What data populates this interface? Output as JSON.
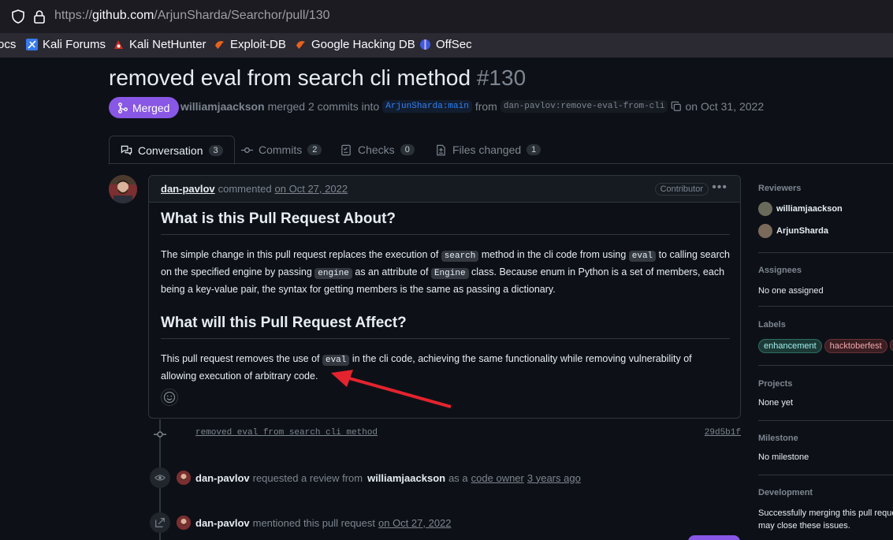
{
  "browser": {
    "url_prefix": "https://",
    "url_host": "github.com",
    "url_path": "/ArjunSharda/Searchor/pull/130"
  },
  "bookmarks": [
    {
      "label": "ocs",
      "icon": "cut-off-icon"
    },
    {
      "label": "Kali Forums",
      "icon": "kali-forums-icon"
    },
    {
      "label": "Kali NetHunter",
      "icon": "nethunter-icon"
    },
    {
      "label": "Exploit-DB",
      "icon": "exploit-db-icon"
    },
    {
      "label": "Google Hacking DB",
      "icon": "ghdb-icon"
    },
    {
      "label": "OffSec",
      "icon": "offsec-icon"
    }
  ],
  "pr": {
    "title": "removed eval from search cli method",
    "number": "#130",
    "state": "Merged",
    "merged_by": "williamjaackson",
    "merged_text": "merged 2 commits into",
    "base_branch": "ArjunSharda:main",
    "from_text": "from",
    "head_branch": "dan-pavlov:remove-eval-from-cli",
    "merged_date": "on Oct 31, 2022"
  },
  "tabs": [
    {
      "label": "Conversation",
      "count": "3"
    },
    {
      "label": "Commits",
      "count": "2"
    },
    {
      "label": "Checks",
      "count": "0"
    },
    {
      "label": "Files changed",
      "count": "1"
    }
  ],
  "comment": {
    "author": "dan-pavlov",
    "action": "commented",
    "date": "on Oct 27, 2022",
    "badge": "Contributor",
    "h1": "What is this Pull Request About?",
    "p1": {
      "t1": "The simple change in this pull request replaces the execution of ",
      "c1": "search",
      "t2": " method in the cli code from using ",
      "c2": "eval",
      "t3": " to calling search on the specified engine by passing ",
      "c3": "engine",
      "t4": " as an attribute of ",
      "c4": "Engine",
      "t5": " class. Because enum in Python is a set of members, each being a key-value pair, the syntax for getting members is the same as passing a dictionary."
    },
    "h2": "What will this Pull Request Affect?",
    "p2": {
      "t1": "This pull request removes the use of ",
      "c1": "eval",
      "t2": " in the cli code, achieving the same functionality while removing vulnerability of allowing execution of arbitrary code."
    }
  },
  "commit": {
    "message": "removed eval from search cli method",
    "sha": "29d5b1f"
  },
  "events": [
    {
      "user": "dan-pavlov",
      "text": "requested a review from",
      "target": "williamjaackson",
      "text2": "as a",
      "link": "code owner",
      "time": "3 years ago"
    },
    {
      "user": "dan-pavlov",
      "text": "mentioned this pull request",
      "time": "on Oct 27, 2022"
    }
  ],
  "sidebar": {
    "reviewers_h": "Reviewers",
    "reviewers": [
      "williamjaackson",
      "ArjunSharda"
    ],
    "assignees_h": "Assignees",
    "assignees": "No one assigned",
    "labels_h": "Labels",
    "labels": [
      "enhancement",
      "hacktoberfest"
    ],
    "projects_h": "Projects",
    "projects": "None yet",
    "milestone_h": "Milestone",
    "milestone": "No milestone",
    "development_h": "Development",
    "development": "Successfully merging this pull request may close these issues."
  },
  "colors": {
    "merged": "#8957e5",
    "arrow": "#e5232e",
    "background": "#0d1117"
  }
}
